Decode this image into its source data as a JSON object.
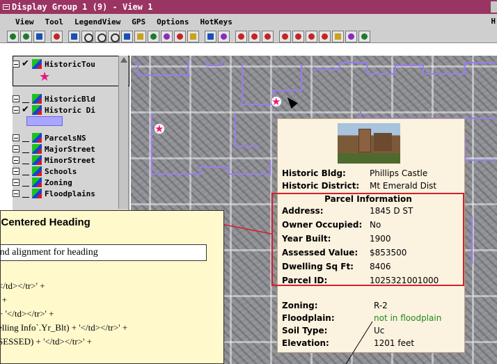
{
  "window": {
    "title": "Display Group 1 (9) - View 1"
  },
  "menu": {
    "items": [
      "View",
      "Tool",
      "LegendView",
      "GPS",
      "Options",
      "HotKeys"
    ],
    "tail": "H"
  },
  "legend": {
    "layers": [
      {
        "name": "HistoricTou",
        "checked": true
      },
      {
        "name": "HistoricBld",
        "checked": false
      },
      {
        "name": "Historic Di",
        "checked": true
      },
      {
        "name": "ParcelsNS",
        "checked": false
      },
      {
        "name": "MajorStreet",
        "checked": false
      },
      {
        "name": "MinorStreet",
        "checked": false
      },
      {
        "name": "Schools",
        "checked": false
      },
      {
        "name": "Zoning",
        "checked": false
      },
      {
        "name": "Floodplains",
        "checked": false
      }
    ],
    "checkmark": "✔",
    "star": "★"
  },
  "popup": {
    "historic_bldg_label": "Historic Bldg:",
    "historic_bldg_value": "Phillips Castle",
    "historic_district_label": "Historic District:",
    "historic_district_value": "Mt Emerald Dist",
    "parcel_heading": "Parcel Information",
    "parcel_rows": [
      {
        "label": "Address:",
        "value": "1845 D ST"
      },
      {
        "label": "Owner Occupied:",
        "value": "No"
      },
      {
        "label": "Year Built:",
        "value": "1900"
      },
      {
        "label": "Assessed Value:",
        "value": "$853500"
      },
      {
        "label": "Dwelling Sq Ft:",
        "value": "8406"
      },
      {
        "label": "Parcel ID:",
        "value": "1025321001000"
      }
    ],
    "zoning_rows": [
      {
        "label": "Zoning:",
        "value": "R-2"
      },
      {
        "label": "Floodplain:",
        "value": "not in floodplain"
      },
      {
        "label": "Soil Type:",
        "value": "Uc"
      },
      {
        "label": "Elevation:",
        "value": "1201 feet"
      }
    ]
  },
  "callout": {
    "title": "ith Centered Heading",
    "subtitle": "ght and alignment for heading",
    "code_lines": [
      "</td></tr>' +",
      "' +",
      "+ '</td></tr>' +",
      "elling Info`.Yr_Blt) + '</td></tr>' +",
      "SESSED) + '</td></tr>' +"
    ]
  },
  "colors": {
    "titlebar": "#9a3462",
    "parcel_border": "#d61f2a",
    "popup_bg": "#fbf2df",
    "callout_bg": "#fff9cc",
    "district_swatch": "#a9a6ff",
    "floodplain_text": "#1f8a1f"
  }
}
